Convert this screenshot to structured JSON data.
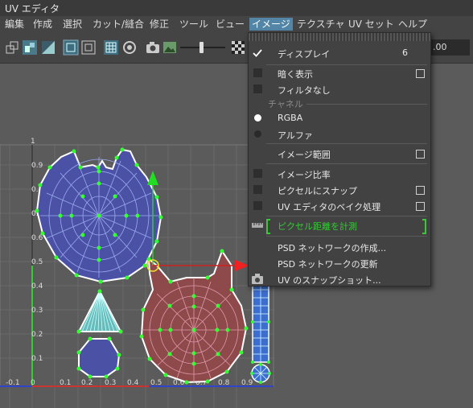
{
  "window": {
    "title": "UV エディタ"
  },
  "menubar": {
    "items": [
      "編集",
      "作成",
      "選択",
      "カット/縫合",
      "修正",
      "ツール",
      "ビュー",
      "イメージ",
      "テクスチャ",
      "UV セット",
      "ヘルプ"
    ],
    "active_index": 7
  },
  "toolbar": {
    "value_field": ".00"
  },
  "viewport": {
    "x_ticks": [
      "-0.1",
      "0",
      "0.1",
      "0.2",
      "0.3",
      "0.4",
      "0.5",
      "0.6",
      "0.7",
      "0.8",
      "0.9"
    ],
    "y_ticks": [
      "1",
      "0.9",
      "0.8",
      "0.7",
      "0.6",
      "0.5",
      "0.4",
      "0.3",
      "0.2",
      "0.1"
    ]
  },
  "image_menu": {
    "items": [
      {
        "label": "ディスプレイ",
        "accel": "6",
        "checked": true
      },
      {
        "label": "暗く表示",
        "option": true
      },
      {
        "label": "フィルタなし"
      },
      {
        "section": "チャネル"
      },
      {
        "label": "RGBA",
        "radio": "on"
      },
      {
        "label": "アルファ",
        "radio": "off"
      },
      {
        "label": "イメージ範囲",
        "option": true
      },
      {
        "label": "イメージ比率"
      },
      {
        "label": "ピクセルにスナップ",
        "option": true
      },
      {
        "label": "UV エディタのベイク処理",
        "option": true
      },
      {
        "label": "ピクセル距離を計測",
        "highlight": true
      },
      {
        "label": "PSD ネットワークの作成..."
      },
      {
        "label": "PSD ネットワークの更新"
      },
      {
        "label": "UV のスナップショット..."
      }
    ]
  },
  "colors": {
    "accent": "#5285a6",
    "blue_shell": "#4b52a6",
    "red_shell": "#8e4a4a",
    "vertex": "#33ff33",
    "measure": "#33cc33"
  }
}
